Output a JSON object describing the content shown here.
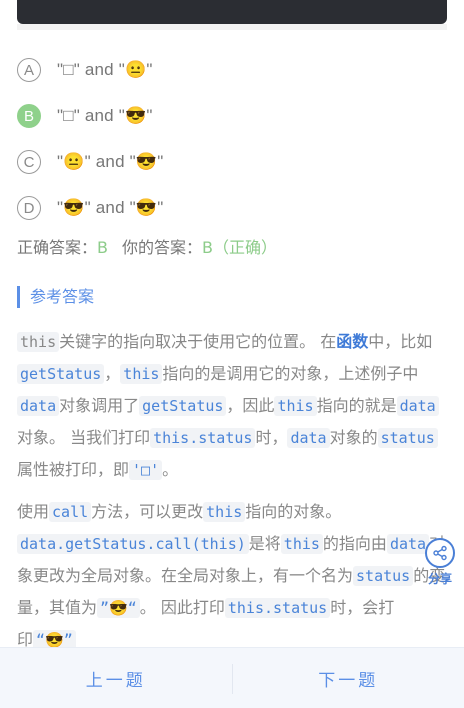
{
  "options": [
    {
      "letter": "A",
      "text": "\"□\" and \"😐\""
    },
    {
      "letter": "B",
      "text": "\"□\" and \"😎\""
    },
    {
      "letter": "C",
      "text": "\"😐\" and \"😎\""
    },
    {
      "letter": "D",
      "text": "\"😎\" and \"😎\""
    }
  ],
  "result": {
    "correct_label": "正确答案：",
    "correct_value": "B",
    "your_label": "你的答案：",
    "your_value": "B（正确）"
  },
  "reference": {
    "title": "参考答案",
    "p1": {
      "t1": "this",
      "t2": "关键字的指向取决于使用它的位置。 在",
      "t3": "函数",
      "t4": "中，比如",
      "t5": "getStatus",
      "t6": "，",
      "t7": "this",
      "t8": "指向的是调用它的对象，上述例子中",
      "t9": "data",
      "t10": "对象调用了",
      "t11": "getStatus",
      "t12": "，因此",
      "t13": "this",
      "t14": "指向的就是",
      "t15": "data",
      "t16": "对象。 当我们打印",
      "t17": "this.status",
      "t18": "时，",
      "t19": "data",
      "t20": "对象的",
      "t21": "status",
      "t22": "属性被打印，即",
      "t23": "'□'",
      "t24": "。"
    },
    "p2": {
      "t1": "使用",
      "t2": "call",
      "t3": "方法，可以更改",
      "t4": "this",
      "t5": "指向的对象。",
      "t6": "data.getStatus.call(this)",
      "t7": "是将",
      "t8": "this",
      "t9": "的指向由",
      "t10": "data",
      "t11": "对象更改为全局对象。在全局对象上，有一个名为",
      "t12": "status",
      "t13": "的变量，其值为",
      "t14": "”😎“",
      "t15": "。 因此打印",
      "t16": "this.status",
      "t17": "时，会打印",
      "t18": "“😎”"
    }
  },
  "share_label": "分享",
  "nav": {
    "prev": "上一题",
    "next": "下一题"
  },
  "colors": {
    "accent": "#5b8fe6",
    "correct": "#8dcc8a"
  }
}
